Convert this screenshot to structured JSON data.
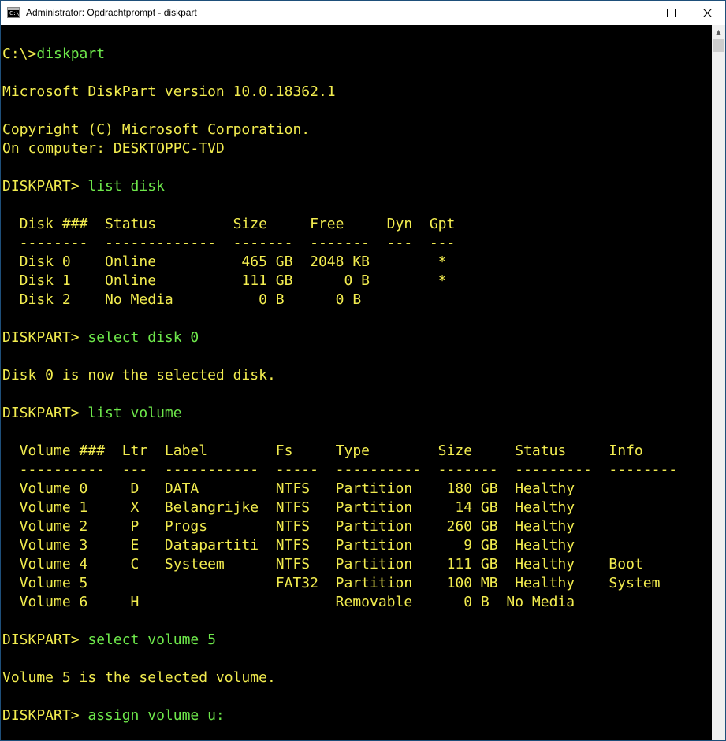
{
  "window": {
    "title": "Administrator: Opdrachtprompt - diskpart",
    "icon": "cmd-icon",
    "icon_glyph": "C:\\."
  },
  "colors": {
    "background": "#000000",
    "output_text": "#f2ec4f",
    "command_text": "#6ee84b",
    "titlebar": "#ffffff"
  },
  "console": {
    "lines": [
      {
        "prompt": "C:\\>",
        "command": "diskpart"
      },
      {
        "text": ""
      },
      {
        "text": "Microsoft DiskPart version 10.0.18362.1"
      },
      {
        "text": ""
      },
      {
        "text": "Copyright (C) Microsoft Corporation."
      },
      {
        "text": "On computer: DESKTOPPC-TVD"
      },
      {
        "text": ""
      },
      {
        "prompt": "DISKPART> ",
        "command": "list disk"
      },
      {
        "text": ""
      },
      {
        "text": "  Disk ###  Status         Size     Free     Dyn  Gpt"
      },
      {
        "text": "  --------  -------------  -------  -------  ---  ---"
      },
      {
        "text": "  Disk 0    Online          465 GB  2048 KB        *"
      },
      {
        "text": "  Disk 1    Online          111 GB      0 B        *"
      },
      {
        "text": "  Disk 2    No Media          0 B      0 B"
      },
      {
        "text": ""
      },
      {
        "prompt": "DISKPART> ",
        "command": "select disk 0"
      },
      {
        "text": ""
      },
      {
        "text": "Disk 0 is now the selected disk."
      },
      {
        "text": ""
      },
      {
        "prompt": "DISKPART> ",
        "command": "list volume"
      },
      {
        "text": ""
      },
      {
        "text": "  Volume ###  Ltr  Label        Fs     Type        Size     Status     Info"
      },
      {
        "text": "  ----------  ---  -----------  -----  ----------  -------  ---------  --------"
      },
      {
        "text": "  Volume 0     D   DATA         NTFS   Partition    180 GB  Healthy"
      },
      {
        "text": "  Volume 1     X   Belangrijke  NTFS   Partition     14 GB  Healthy"
      },
      {
        "text": "  Volume 2     P   Progs        NTFS   Partition    260 GB  Healthy"
      },
      {
        "text": "  Volume 3     E   Datapartiti  NTFS   Partition      9 GB  Healthy"
      },
      {
        "text": "  Volume 4     C   Systeem      NTFS   Partition    111 GB  Healthy    Boot"
      },
      {
        "text": "  Volume 5                      FAT32  Partition    100 MB  Healthy    System"
      },
      {
        "text": "  Volume 6     H                       Removable      0 B  No Media"
      },
      {
        "text": ""
      },
      {
        "prompt": "DISKPART> ",
        "command": "select volume 5"
      },
      {
        "text": ""
      },
      {
        "text": "Volume 5 is the selected volume."
      },
      {
        "text": ""
      },
      {
        "prompt": "DISKPART> ",
        "command": "assign volume u:"
      }
    ]
  },
  "scrollbar": {
    "up_arrow": "▲"
  }
}
